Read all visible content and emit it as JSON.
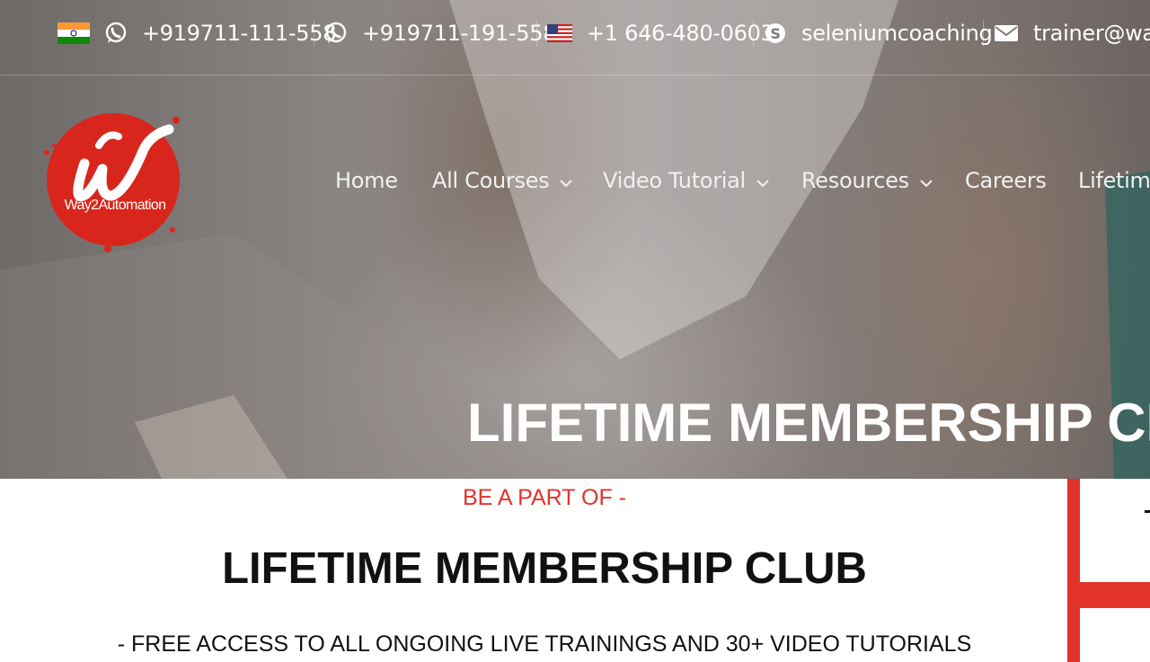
{
  "topbar": {
    "contacts": [
      {
        "icon": "whatsapp-icon",
        "flag": "india-flag-icon",
        "text": "+919711-111-558"
      },
      {
        "icon": "whatsapp-icon",
        "text": "+919711-191-558"
      },
      {
        "icon": "usa-flag-icon",
        "text": "+1 646-480-0603"
      },
      {
        "icon": "skype-icon",
        "text": "seleniumcoaching"
      },
      {
        "icon": "envelope-icon",
        "text": "trainer@way"
      }
    ]
  },
  "logo": {
    "text": "Way2Automation"
  },
  "nav": {
    "items": [
      {
        "label": "Home"
      },
      {
        "label": "All Courses",
        "has_dropdown": true
      },
      {
        "label": "Video Tutorial",
        "has_dropdown": true
      },
      {
        "label": "Resources",
        "has_dropdown": true
      },
      {
        "label": "Careers"
      },
      {
        "label": "Lifetime"
      }
    ]
  },
  "hero": {
    "title": "LIFETIME MEMBERSHIP CL"
  },
  "content": {
    "kicker": "BE A PART OF -",
    "title": "LIFETIME MEMBERSHIP CLUB",
    "subline": "- FREE ACCESS TO ALL ONGOING LIVE TRAININGS AND 30+ VIDEO TUTORIALS"
  },
  "colors": {
    "accent": "#e1332a",
    "logo_red": "#d9261c",
    "text_dark": "#111111"
  }
}
